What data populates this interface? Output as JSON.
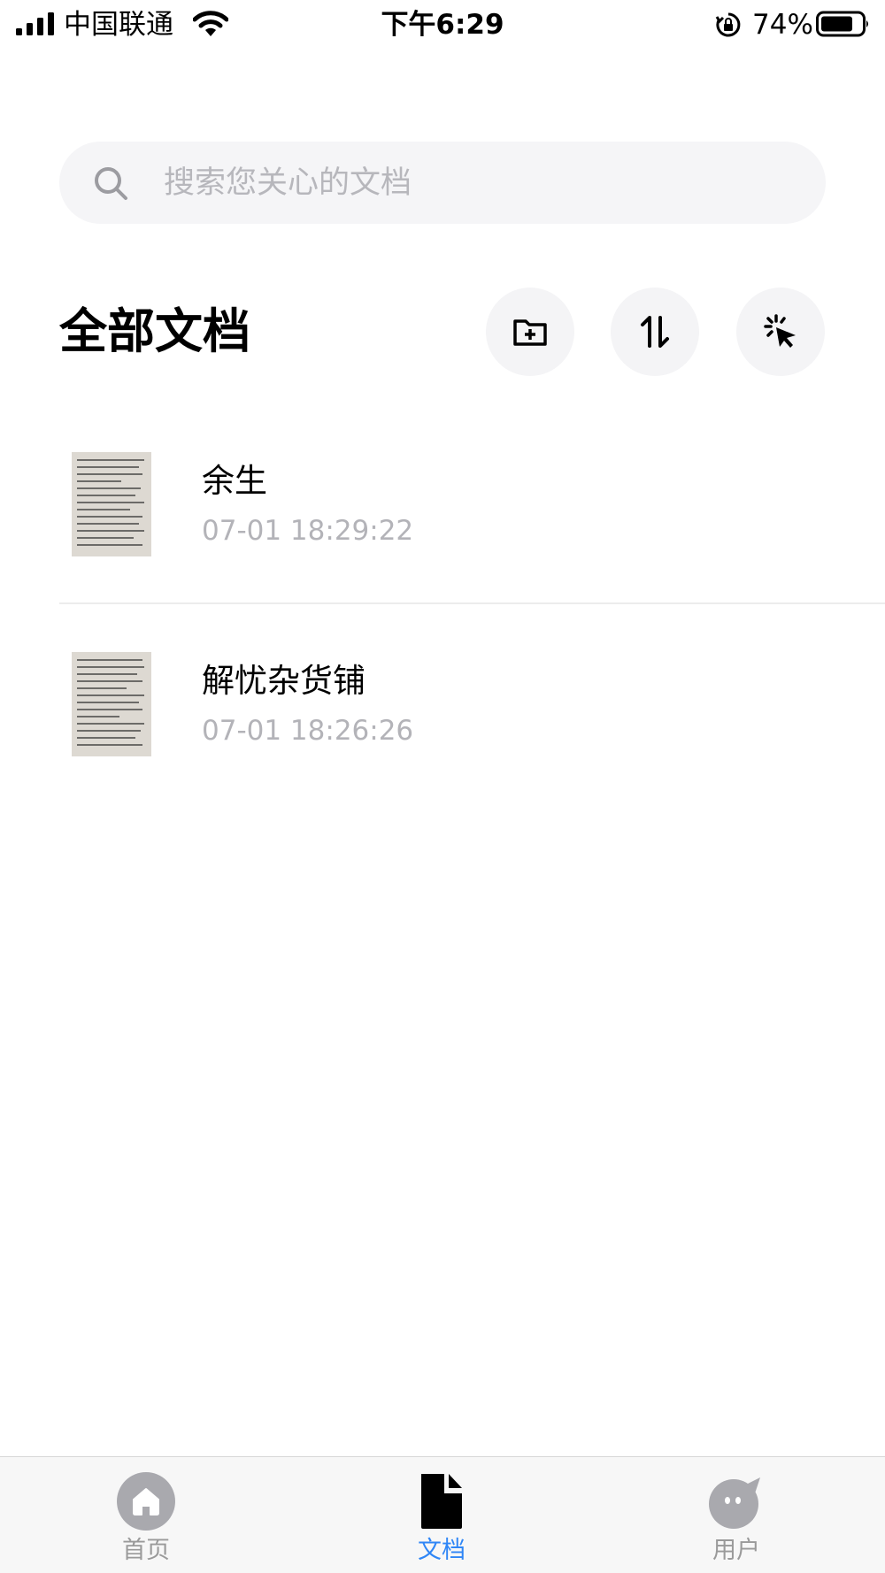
{
  "status_bar": {
    "carrier": "中国联通",
    "time": "下午6:29",
    "battery": "74%"
  },
  "search": {
    "placeholder": "搜索您关心的文档",
    "value": ""
  },
  "header": {
    "title": "全部文档",
    "actions": [
      "folder-add-icon",
      "sort-icon",
      "select-icon"
    ]
  },
  "documents": [
    {
      "title": "余生",
      "time": "07-01 18:29:22"
    },
    {
      "title": "解忧杂货铺",
      "time": "07-01 18:26:26"
    }
  ],
  "tab_bar": {
    "active": 1,
    "accent_color": "#2f86f6",
    "tabs": [
      {
        "label": "首页",
        "icon": "home-icon"
      },
      {
        "label": "文档",
        "icon": "document-icon"
      },
      {
        "label": "用户",
        "icon": "user-icon"
      }
    ]
  }
}
